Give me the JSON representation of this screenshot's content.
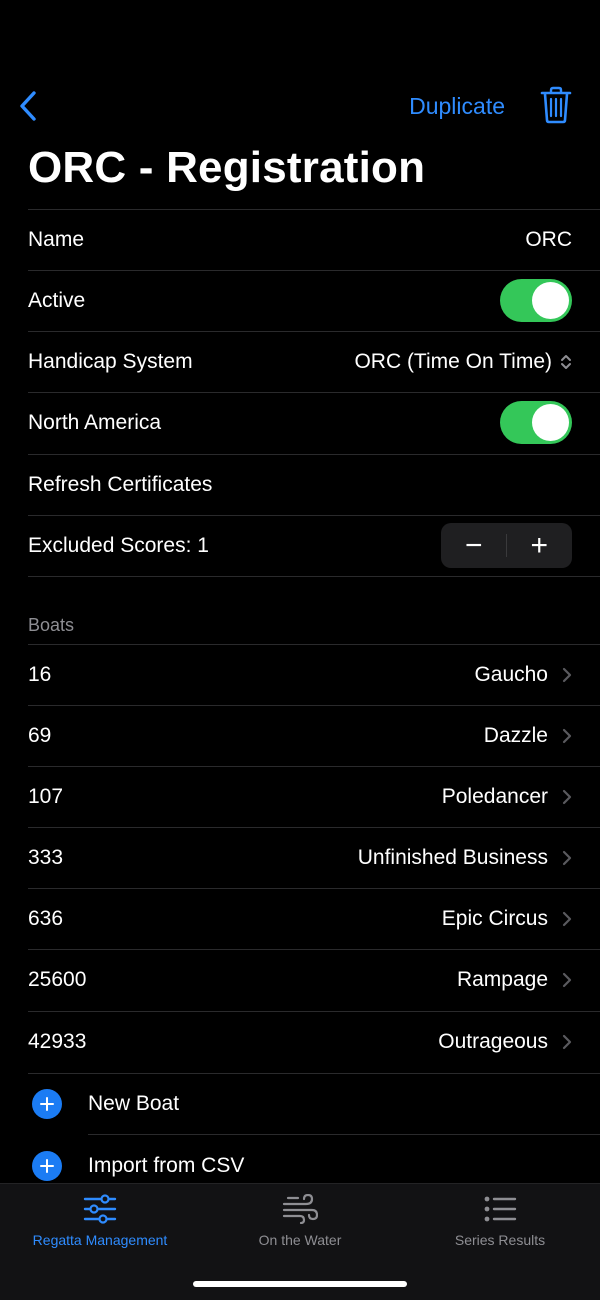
{
  "nav": {
    "duplicate_label": "Duplicate",
    "back_icon": "chevron-left-icon",
    "trash_icon": "trash-icon",
    "accent_color": "#2f8cff"
  },
  "title": "ORC - Registration",
  "settings": {
    "name_label": "Name",
    "name_value": "ORC",
    "active_label": "Active",
    "active_on": true,
    "handicap_label": "Handicap System",
    "handicap_value": "ORC (Time On Time)",
    "north_america_label": "North America",
    "north_america_on": true,
    "refresh_label": "Refresh Certificates",
    "excluded_label": "Excluded Scores: 1",
    "stepper_minus": "−",
    "stepper_plus": "+"
  },
  "boats": {
    "header": "Boats",
    "items": [
      {
        "number": "16",
        "name": "Gaucho"
      },
      {
        "number": "69",
        "name": "Dazzle"
      },
      {
        "number": "107",
        "name": "Poledancer"
      },
      {
        "number": "333",
        "name": "Unfinished Business"
      },
      {
        "number": "636",
        "name": "Epic Circus"
      },
      {
        "number": "25600",
        "name": "Rampage"
      },
      {
        "number": "42933",
        "name": "Outrageous"
      }
    ],
    "new_boat_label": "New Boat",
    "import_label": "Import from CSV"
  },
  "tabs": [
    {
      "label": "Regatta Management",
      "icon": "sliders-icon",
      "active": true
    },
    {
      "label": "On the Water",
      "icon": "wind-icon",
      "active": false
    },
    {
      "label": "Series Results",
      "icon": "list-icon",
      "active": false
    }
  ],
  "colors": {
    "toggle_on": "#34c759",
    "add_button": "#1b7cf4"
  }
}
